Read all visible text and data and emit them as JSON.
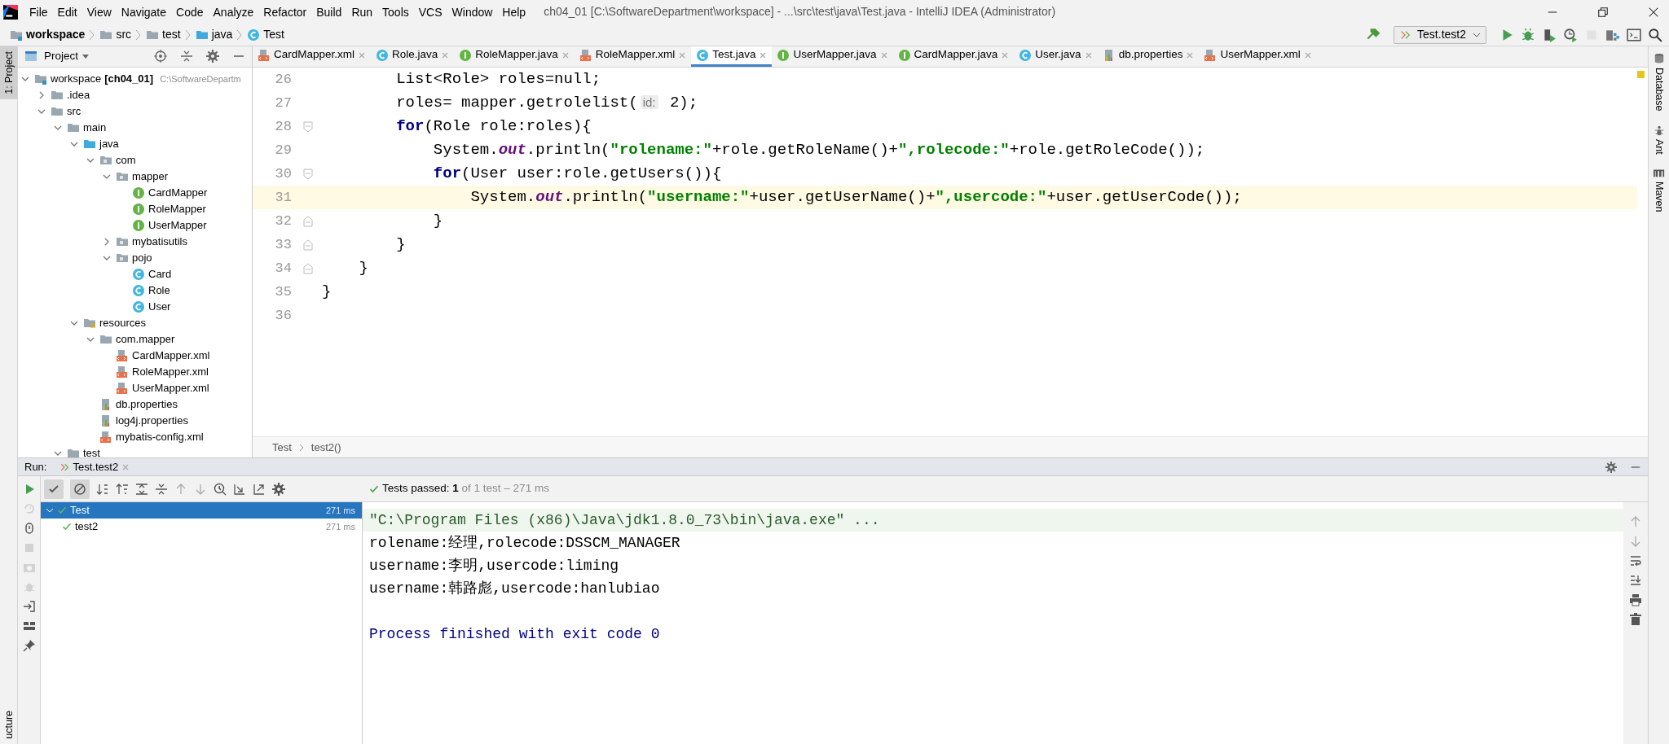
{
  "menu": [
    "File",
    "Edit",
    "View",
    "Navigate",
    "Code",
    "Analyze",
    "Refactor",
    "Build",
    "Run",
    "Tools",
    "VCS",
    "Window",
    "Help"
  ],
  "window": {
    "title": "ch04_01 [C:\\SoftwareDepartment\\workspace] - ...\\src\\test\\java\\Test.java - IntelliJ IDEA (Administrator)"
  },
  "breadcrumb": [
    {
      "label": "workspace",
      "kind": "module"
    },
    {
      "label": "src",
      "kind": "folder"
    },
    {
      "label": "test",
      "kind": "folder"
    },
    {
      "label": "java",
      "kind": "source"
    },
    {
      "label": "Test",
      "kind": "class"
    }
  ],
  "toolbar": [
    {
      "kind": "build",
      "disabled": false
    },
    {
      "kind": "config",
      "label": "Test.test2",
      "disabled": false
    },
    {
      "kind": "run",
      "disabled": false
    },
    {
      "kind": "debug",
      "disabled": false
    },
    {
      "kind": "coverage",
      "disabled": false
    },
    {
      "kind": "profile",
      "disabled": false
    },
    {
      "kind": "stop",
      "disabled": true
    },
    {
      "kind": "structure",
      "disabled": false
    },
    {
      "kind": "terminal",
      "disabled": false
    },
    {
      "kind": "search",
      "disabled": false
    }
  ],
  "left_tools": [
    {
      "label": "1: Project",
      "selected": true
    }
  ],
  "left_tools_bottom": "ucture",
  "right_tools": [
    {
      "label": "Database",
      "kind": "database"
    },
    {
      "label": "Ant",
      "kind": "ant"
    },
    {
      "label": "Maven",
      "kind": "maven"
    }
  ],
  "project": {
    "title": "Project",
    "tree": [
      {
        "label": "workspace",
        "module": "[ch04_01]",
        "path": "C:\\SoftwareDepartm",
        "kind": "module",
        "expanded": true,
        "children": [
          {
            "label": ".idea",
            "kind": "folder",
            "expanded": false
          },
          {
            "label": "src",
            "kind": "folder",
            "expanded": true,
            "children": [
              {
                "label": "main",
                "kind": "folder",
                "expanded": true,
                "children": [
                  {
                    "label": "java",
                    "kind": "source",
                    "expanded": true,
                    "children": [
                      {
                        "label": "com",
                        "kind": "package",
                        "expanded": true,
                        "children": [
                          {
                            "label": "mapper",
                            "kind": "package",
                            "expanded": true,
                            "children": [
                              {
                                "label": "CardMapper",
                                "kind": "interface"
                              },
                              {
                                "label": "RoleMapper",
                                "kind": "interface"
                              },
                              {
                                "label": "UserMapper",
                                "kind": "interface"
                              }
                            ]
                          },
                          {
                            "label": "mybatisutils",
                            "kind": "package",
                            "expanded": false
                          },
                          {
                            "label": "pojo",
                            "kind": "package",
                            "expanded": true,
                            "children": [
                              {
                                "label": "Card",
                                "kind": "class"
                              },
                              {
                                "label": "Role",
                                "kind": "class"
                              },
                              {
                                "label": "User",
                                "kind": "class"
                              }
                            ]
                          }
                        ]
                      }
                    ]
                  },
                  {
                    "label": "resources",
                    "kind": "resources",
                    "expanded": true,
                    "children": [
                      {
                        "label": "com.mapper",
                        "kind": "folder",
                        "expanded": true,
                        "children": [
                          {
                            "label": "CardMapper.xml",
                            "kind": "xml"
                          },
                          {
                            "label": "RoleMapper.xml",
                            "kind": "xml"
                          },
                          {
                            "label": "UserMapper.xml",
                            "kind": "xml"
                          }
                        ]
                      },
                      {
                        "label": "db.properties",
                        "kind": "properties"
                      },
                      {
                        "label": "log4j.properties",
                        "kind": "properties"
                      },
                      {
                        "label": "mybatis-config.xml",
                        "kind": "xml"
                      }
                    ]
                  }
                ]
              },
              {
                "label": "test",
                "kind": "folder",
                "expanded": true
              }
            ]
          }
        ]
      }
    ]
  },
  "editor": {
    "tabs": [
      {
        "label": "CardMapper.xml",
        "kind": "xml",
        "selected": false
      },
      {
        "label": "Role.java",
        "kind": "class",
        "selected": false
      },
      {
        "label": "RoleMapper.java",
        "kind": "interface",
        "selected": false
      },
      {
        "label": "RoleMapper.xml",
        "kind": "xml",
        "selected": false
      },
      {
        "label": "Test.java",
        "kind": "class",
        "selected": true
      },
      {
        "label": "UserMapper.java",
        "kind": "interface",
        "selected": false
      },
      {
        "label": "CardMapper.java",
        "kind": "interface",
        "selected": false
      },
      {
        "label": "User.java",
        "kind": "class",
        "selected": false
      },
      {
        "label": "db.properties",
        "kind": "properties",
        "selected": false
      },
      {
        "label": "UserMapper.xml",
        "kind": "xml",
        "selected": false
      }
    ],
    "lines": [
      {
        "number": "26",
        "selected": false,
        "kind": "plain",
        "tokens": [
          {
            "text": "        List<Role> roles=null;",
            "kind": "plain"
          }
        ]
      },
      {
        "number": "27",
        "selected": false,
        "kind": "plain",
        "tokens": [
          {
            "text": "        roles= mapper.getrolelist(",
            "kind": "plain"
          },
          {
            "text": "id:",
            "kind": "hint"
          },
          {
            "text": " 2);",
            "kind": "plain"
          }
        ]
      },
      {
        "number": "28",
        "selected": false,
        "kind": "fold-start",
        "tokens": [
          {
            "text": "        for",
            "kind": "keyword"
          },
          {
            "text": "(Role role:roles){",
            "kind": "plain"
          }
        ]
      },
      {
        "number": "29",
        "selected": false,
        "kind": "plain",
        "tokens": [
          {
            "text": "            System.",
            "kind": "plain"
          },
          {
            "text": "out",
            "kind": "field"
          },
          {
            "text": ".println(",
            "kind": "plain"
          },
          {
            "text": "\"rolename:\"",
            "kind": "string"
          },
          {
            "text": "+role.getRoleName()+",
            "kind": "plain"
          },
          {
            "text": "\",rolecode:\"",
            "kind": "string"
          },
          {
            "text": "+role.getRoleCode());",
            "kind": "plain"
          }
        ]
      },
      {
        "number": "30",
        "selected": false,
        "kind": "fold-start",
        "tokens": [
          {
            "text": "            for",
            "kind": "keyword"
          },
          {
            "text": "(User user:role.getUsers()){",
            "kind": "plain"
          }
        ]
      },
      {
        "number": "31",
        "selected": true,
        "kind": "plain",
        "tokens": [
          {
            "text": "                System.",
            "kind": "plain"
          },
          {
            "text": "out",
            "kind": "field"
          },
          {
            "text": ".println(",
            "kind": "plain"
          },
          {
            "text": "\"username:\"",
            "kind": "string"
          },
          {
            "text": "+user.getUserName()+",
            "kind": "plain"
          },
          {
            "text": "\",usercode:\"",
            "kind": "string"
          },
          {
            "text": "+user.getUserCode());",
            "kind": "plain"
          }
        ]
      },
      {
        "number": "32",
        "selected": false,
        "kind": "fold-end",
        "tokens": [
          {
            "text": "            }",
            "kind": "plain"
          }
        ]
      },
      {
        "number": "33",
        "selected": false,
        "kind": "fold-end",
        "tokens": [
          {
            "text": "        }",
            "kind": "plain"
          }
        ]
      },
      {
        "number": "34",
        "selected": false,
        "kind": "fold-end",
        "tokens": [
          {
            "text": "    }",
            "kind": "plain"
          }
        ]
      },
      {
        "number": "35",
        "selected": false,
        "kind": "plain",
        "tokens": [
          {
            "text": "}",
            "kind": "plain"
          }
        ]
      },
      {
        "number": "36",
        "selected": false,
        "kind": "plain"
      }
    ],
    "breadcrumb": [
      "Test",
      "test2()"
    ]
  },
  "run": {
    "label": "Run:",
    "tab": "Test.test2",
    "filters": [
      {
        "kind": "passed",
        "on": true
      },
      {
        "kind": "ignored",
        "on": true
      }
    ],
    "side_actions": [
      {
        "kind": "rerun",
        "disabled": false
      },
      {
        "kind": "rerun-failed",
        "disabled": true
      },
      {
        "kind": "toggle-auto",
        "disabled": false
      },
      {
        "kind": "stop",
        "disabled": true
      },
      {
        "kind": "camera",
        "disabled": true
      },
      {
        "kind": "debug",
        "disabled": true
      },
      {
        "kind": "exit",
        "disabled": false
      },
      {
        "kind": "layout",
        "disabled": false
      },
      {
        "kind": "pin",
        "disabled": false
      }
    ],
    "status": {
      "label": "Tests passed:",
      "count": "1",
      "detail": "of 1 test – 271 ms"
    },
    "tests": [
      {
        "name": "Test",
        "time": "271 ms",
        "passed": true,
        "selected": true,
        "children": [
          {
            "name": "test2",
            "time": "271 ms",
            "passed": true,
            "selected": false
          }
        ]
      }
    ],
    "console": [
      {
        "text": "\"C:\\Program Files (x86)\\Java\\jdk1.8.0_73\\bin\\java.exe\" ...",
        "kind": "command"
      },
      {
        "text": "rolename:经理,rolecode:DSSCM_MANAGER",
        "kind": "output"
      },
      {
        "text": "username:李明,usercode:liming",
        "kind": "output"
      },
      {
        "text": "username:韩路彪,usercode:hanlubiao",
        "kind": "output"
      },
      {
        "text": "Process finished with exit code 0",
        "kind": "exit"
      }
    ]
  }
}
